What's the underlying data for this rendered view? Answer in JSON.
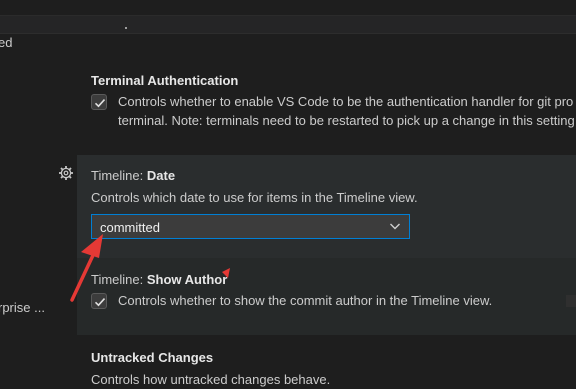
{
  "left_cut_texts": [
    "ed",
    "rprise ..."
  ],
  "settings": [
    {
      "category": "",
      "name": "Terminal Authentication",
      "description_lines": [
        "Controls whether to enable VS Code to be the authentication handler for git pro",
        "terminal. Note: terminals need to be restarted to pick up a change in this setting"
      ],
      "checked": true
    },
    {
      "category": "Timeline: ",
      "name": "Date",
      "description": "Controls which date to use for items in the Timeline view.",
      "select_value": "committed"
    },
    {
      "category": "Timeline: ",
      "name": "Show Author",
      "description": "Controls whether to show the commit author in the Timeline view.",
      "checked": true
    },
    {
      "category": "",
      "name": "Untracked Changes",
      "description": "Controls how untracked changes behave."
    }
  ],
  "icons": [
    "gear-icon",
    "check-icon",
    "chevron-down-icon"
  ],
  "colors": {
    "focus_border": "#007fd4",
    "annotation_arrow": "#e53935",
    "background": "#1e1e1e"
  }
}
